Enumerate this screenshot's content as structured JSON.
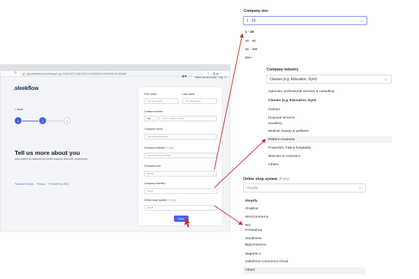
{
  "browser": {
    "url": "app.sleekflow.io/en-US/signup?_ga=2.251126274.284275610.1676284849-1476180288.1676284849",
    "nav_icons": [
      "back-arrow-icon",
      "forward-arrow-icon",
      "reload-icon",
      "lock-icon"
    ],
    "right_icons": [
      "share-icon",
      "star-icon",
      "extensions-icon",
      "profile-icon"
    ]
  },
  "left": {
    "logo": ".sleekflow",
    "back_label": "< Back",
    "steps": [
      "1",
      "2",
      "3"
    ],
    "heading": "Tell us more about you",
    "subtext": "Information is collected for better support and user experience.",
    "footer": {
      "terms": "Terms of Service",
      "privacy": "Privacy",
      "copyright": "© SleekFlow 2022"
    },
    "accent": "#4561e6"
  },
  "header": {
    "have_account": "Have an account?",
    "sign_in": "Sign in"
  },
  "form": {
    "first_name_label": "First name",
    "first_name_placeholder": "Your first name",
    "last_name_label": "Last name",
    "last_name_placeholder": "Your last name",
    "contact_label": "Contact number",
    "country_code": "+62",
    "contact_placeholder": "Enter contact number",
    "company_name_label": "Company name",
    "company_name_placeholder": "Your company name",
    "company_website_label": "Company website",
    "company_website_optional": "(If any)",
    "company_website_placeholder": "Your company website",
    "company_size_label": "Company size",
    "company_size_value": "Select",
    "company_industry_label": "Company industry",
    "company_industry_value": "Select",
    "online_shop_label": "Online shop system",
    "online_shop_optional": "(If any)",
    "online_shop_value": "Select",
    "next_label": "Next",
    "button_color": "#4a63e8"
  },
  "company_size_zoom": {
    "label": "Company size",
    "selected": "1 - 19",
    "options": [
      "1 - 19",
      "20 - 49",
      "50 - 499",
      "500+"
    ]
  },
  "company_industry_zoom": {
    "label": "Company industry",
    "selected": "Classes (e.g. Education, Gym)",
    "options": [
      "Agencies, professional services & consulting",
      "Classes (e.g. Education, Gym)",
      "Fashion",
      "Financial services",
      "Jewellery",
      "Medical, beauty & wellness",
      "Platform business",
      "Properties, F&B & hospitality",
      "Skincare & cosmetics",
      "Others"
    ]
  },
  "online_shop_zoom": {
    "label": "Online shop system",
    "optional": "(If any)",
    "selected": "Shopify",
    "options": [
      "Shopify",
      "Shopline",
      "WooCommerce",
      "Wix",
      "Prestashop",
      "WordPress",
      "BigCommerce",
      "Magneto 2",
      "Salesforce Commerce Cloud",
      "Others"
    ]
  },
  "annotation_color": "#d0262b"
}
